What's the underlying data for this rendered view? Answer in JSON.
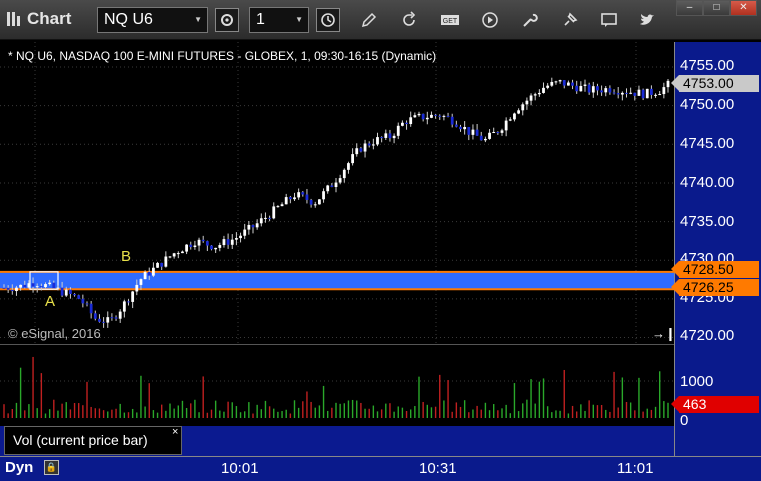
{
  "window": {
    "title": "Chart",
    "symbol": "NQ U6",
    "interval": "1"
  },
  "chart": {
    "header": "* NQ U6, NASDAQ 100 E-MINI FUTURES - GLOBEX, 1, 09:30-16:15 (Dynamic)",
    "copyright": "© eSignal, 2016",
    "label_a": "A",
    "label_b": "B",
    "price_ticks": [
      "4755.00",
      "4750.00",
      "4745.00",
      "4740.00",
      "4735.00",
      "4730.00",
      "4725.00",
      "4720.00"
    ],
    "last_price": "4753.00",
    "zone_top": "4728.50",
    "zone_bottom": "4726.25",
    "vol_ticks": [
      "1000",
      "0"
    ],
    "vol_last": "463",
    "vol_label": "Vol (current price bar)",
    "vol_close": "×",
    "time_labels": [
      "10:01",
      "10:31",
      "11:01"
    ],
    "mode": "Dyn",
    "colors": {
      "up_candle": "#ffffff",
      "down_candle": "#1a2bd6",
      "zone_fill": "#2f6bff",
      "zone_border": "#ff7a00",
      "vol_up": "#2aa82a",
      "vol_down": "#c02020"
    }
  }
}
